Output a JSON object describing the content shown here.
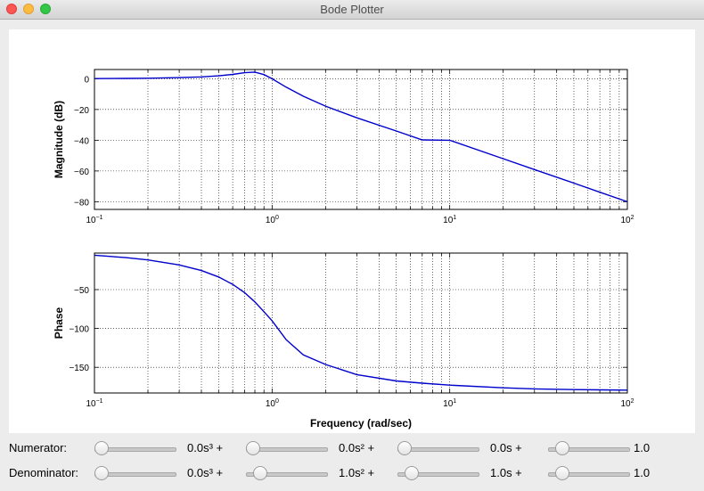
{
  "window": {
    "title": "Bode Plotter",
    "buttons": [
      "close",
      "minimize",
      "zoom"
    ]
  },
  "chart_data": [
    {
      "type": "line",
      "panel": "magnitude",
      "title": "",
      "xlabel": "",
      "ylabel": "Magnitude (dB)",
      "xscale": "log",
      "xlim": [
        0.1,
        100
      ],
      "ylim": [
        -85,
        6
      ],
      "yticks": [
        0,
        -20,
        -40,
        -60,
        -80
      ],
      "ytick_labels": [
        "0",
        "−20",
        "−40",
        "−60",
        "−80"
      ],
      "xtick_labels": [
        {
          "base": "10",
          "exp": "−1"
        },
        {
          "base": "10",
          "exp": "0"
        },
        {
          "base": "10",
          "exp": "1"
        },
        {
          "base": "10",
          "exp": "2"
        }
      ],
      "grid": true,
      "line_color": "#0000cc",
      "x": [
        0.1,
        0.15,
        0.2,
        0.3,
        0.4,
        0.5,
        0.6,
        0.7,
        0.8,
        0.9,
        1.0,
        1.2,
        1.5,
        2,
        3,
        5,
        7,
        10,
        20,
        30,
        50,
        70,
        100
      ],
      "y": [
        0.1,
        0.2,
        0.3,
        0.7,
        1.2,
        1.9,
        2.8,
        3.9,
        4.3,
        2.7,
        0,
        -5.5,
        -11.4,
        -17.8,
        -25.4,
        -34.0,
        -39.8,
        -40,
        -52.0,
        -59.1,
        -67.9,
        -73.8,
        -80.0
      ]
    },
    {
      "type": "line",
      "panel": "phase",
      "title": "",
      "xlabel": "Frequency (rad/sec)",
      "ylabel": "Phase",
      "xscale": "log",
      "xlim": [
        0.1,
        100
      ],
      "ylim": [
        -183,
        -3
      ],
      "yticks": [
        -50,
        -100,
        -150
      ],
      "ytick_labels": [
        "−50",
        "−100",
        "−150"
      ],
      "xtick_labels": [
        {
          "base": "10",
          "exp": "−1"
        },
        {
          "base": "10",
          "exp": "0"
        },
        {
          "base": "10",
          "exp": "1"
        },
        {
          "base": "10",
          "exp": "2"
        }
      ],
      "grid": true,
      "line_color": "#0000cc",
      "x": [
        0.1,
        0.15,
        0.2,
        0.3,
        0.4,
        0.5,
        0.6,
        0.7,
        0.8,
        0.9,
        1.0,
        1.2,
        1.5,
        2,
        3,
        5,
        7,
        10,
        20,
        30,
        50,
        70,
        100
      ],
      "y": [
        -5.8,
        -8.8,
        -11.8,
        -18.3,
        -25.5,
        -33.7,
        -43.2,
        -53.9,
        -65.8,
        -78.4,
        -90,
        -114.4,
        -134.0,
        -146.3,
        -159.4,
        -167.5,
        -170.4,
        -172.9,
        -176.4,
        -177.7,
        -178.6,
        -179.0,
        -179.3
      ]
    }
  ],
  "controls": {
    "numerator": {
      "label": "Numerator:",
      "coefficients": [
        {
          "value": 0,
          "text": "0.0s³ +"
        },
        {
          "value": 0,
          "text": "0.0s² +"
        },
        {
          "value": 0,
          "text": "0.0s +"
        },
        {
          "value": 1,
          "text": "1.0"
        }
      ]
    },
    "denominator": {
      "label": "Denominator:",
      "coefficients": [
        {
          "value": 0,
          "text": "0.0s³ +"
        },
        {
          "value": 1,
          "text": "1.0s² +"
        },
        {
          "value": 1,
          "text": "1.0s +"
        },
        {
          "value": 1,
          "text": "1.0"
        }
      ]
    }
  }
}
